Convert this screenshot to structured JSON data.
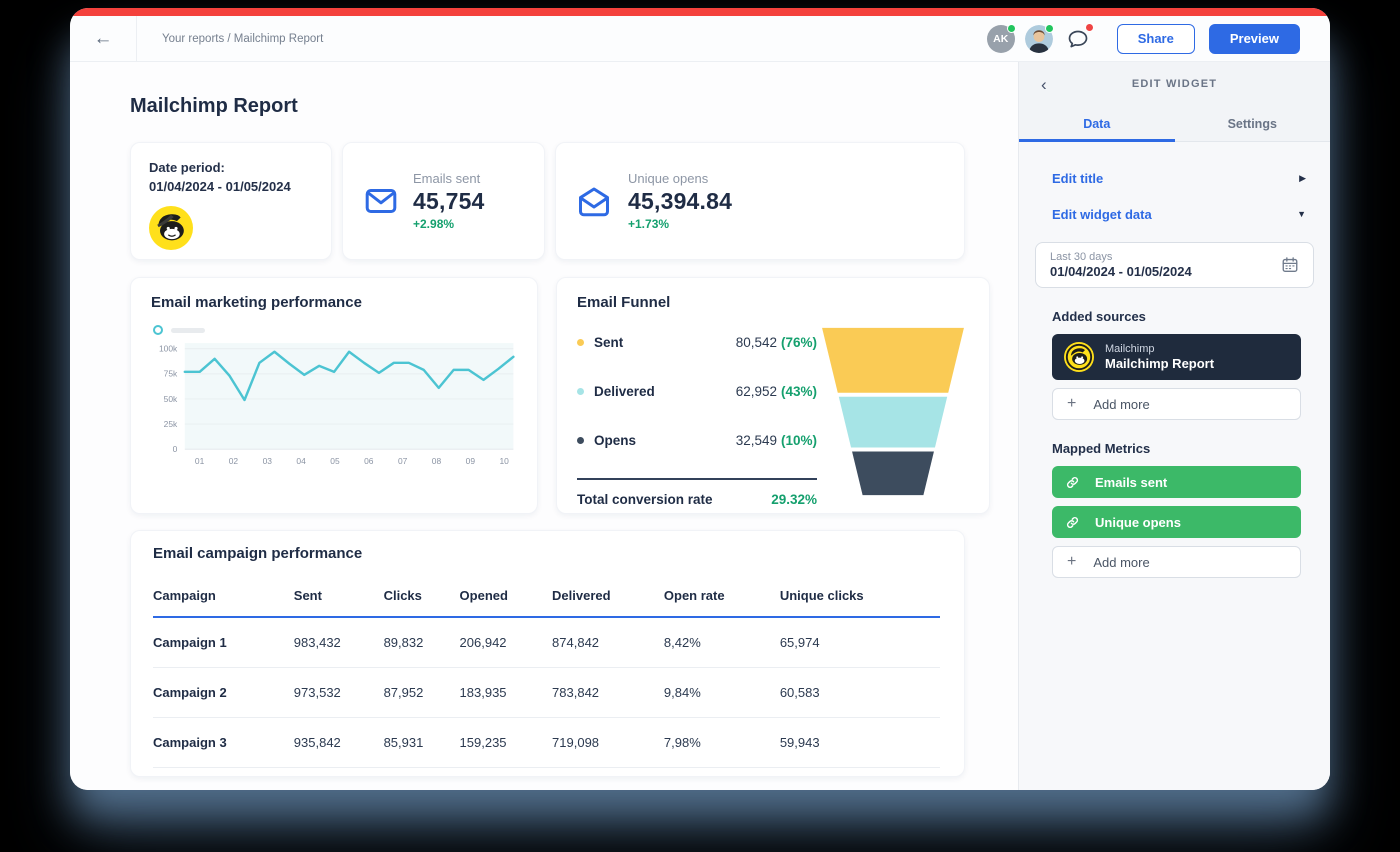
{
  "topbar": {
    "breadcrumb": "Your reports / Mailchimp Report",
    "avatar_initials": "AK",
    "share_label": "Share",
    "preview_label": "Preview"
  },
  "page": {
    "title": "Mailchimp Report"
  },
  "cards": {
    "date_period": {
      "label": "Date period:",
      "range": "01/04/2024 - 01/05/2024"
    },
    "emails_sent": {
      "label": "Emails sent",
      "value": "45,754",
      "delta": "+2.98%"
    },
    "unique_opens": {
      "label": "Unique opens",
      "value": "45,394.84",
      "delta": "+1.73%"
    }
  },
  "chart_data": [
    {
      "type": "line",
      "title": "Email marketing performance",
      "x_tick_labels": [
        "01",
        "02",
        "03",
        "04",
        "05",
        "06",
        "07",
        "08",
        "09",
        "10"
      ],
      "values": [
        77,
        77,
        90,
        73,
        49,
        86,
        97,
        85,
        74,
        83,
        77,
        97,
        86,
        76,
        86,
        86,
        79,
        61,
        79,
        79,
        69,
        80,
        92
      ],
      "unit": "thousands",
      "ylim": [
        0,
        100
      ],
      "yticks": [
        "100k",
        "75k",
        "50k",
        "25k",
        "0"
      ],
      "line_color": "#4CC4D2",
      "grid": true,
      "legend": "unlabeled-series"
    },
    {
      "type": "funnel",
      "title": "Email Funnel",
      "stages": [
        {
          "label": "Sent",
          "value": "80,542",
          "percent": "(76%)",
          "color": "#FACB55"
        },
        {
          "label": "Delivered",
          "value": "62,952",
          "percent": "(43%)",
          "color": "#A6E4E6"
        },
        {
          "label": "Opens",
          "value": "32,549",
          "percent": "(10%)",
          "color": "#3D4C5E"
        }
      ],
      "total_label": "Total conversion rate",
      "total_value": "29.32%"
    }
  ],
  "table": {
    "title": "Email campaign performance",
    "headers": [
      "Campaign",
      "Sent",
      "Clicks",
      "Opened",
      "Delivered",
      "Open rate",
      "Unique clicks"
    ],
    "rows": [
      [
        "Campaign 1",
        "983,432",
        "89,832",
        "206,942",
        "874,842",
        "8,42%",
        "65,974"
      ],
      [
        "Campaign 2",
        "973,532",
        "87,952",
        "183,935",
        "783,842",
        "9,84%",
        "60,583"
      ],
      [
        "Campaign 3",
        "935,842",
        "85,931",
        "159,235",
        "719,098",
        "7,98%",
        "59,943"
      ]
    ]
  },
  "panel": {
    "title": "EDIT WIDGET",
    "tabs": [
      {
        "label": "Data",
        "active": true
      },
      {
        "label": "Settings",
        "active": false
      }
    ],
    "edit_title_label": "Edit title",
    "edit_widget_data_label": "Edit widget data",
    "date_selector": {
      "preset": "Last 30 days",
      "range": "01/04/2024 - 01/05/2024"
    },
    "added_sources_label": "Added sources",
    "source": {
      "provider": "Mailchimp",
      "name": "Mailchimp Report"
    },
    "add_more_label": "Add more",
    "mapped_metrics_label": "Mapped Metrics",
    "metrics": [
      "Emails sent",
      "Unique opens"
    ]
  },
  "colors": {
    "accent_blue": "#2E6AE4",
    "positive_green": "#15A06E",
    "top_bar_red": "#F4413C",
    "line_teal": "#4CC4D2",
    "funnel_yellow": "#FACB55",
    "funnel_light_teal": "#A6E4E6",
    "funnel_dark_slate": "#3D4C5E",
    "metric_green": "#3CB968",
    "source_card_navy": "#1F2B3D"
  }
}
